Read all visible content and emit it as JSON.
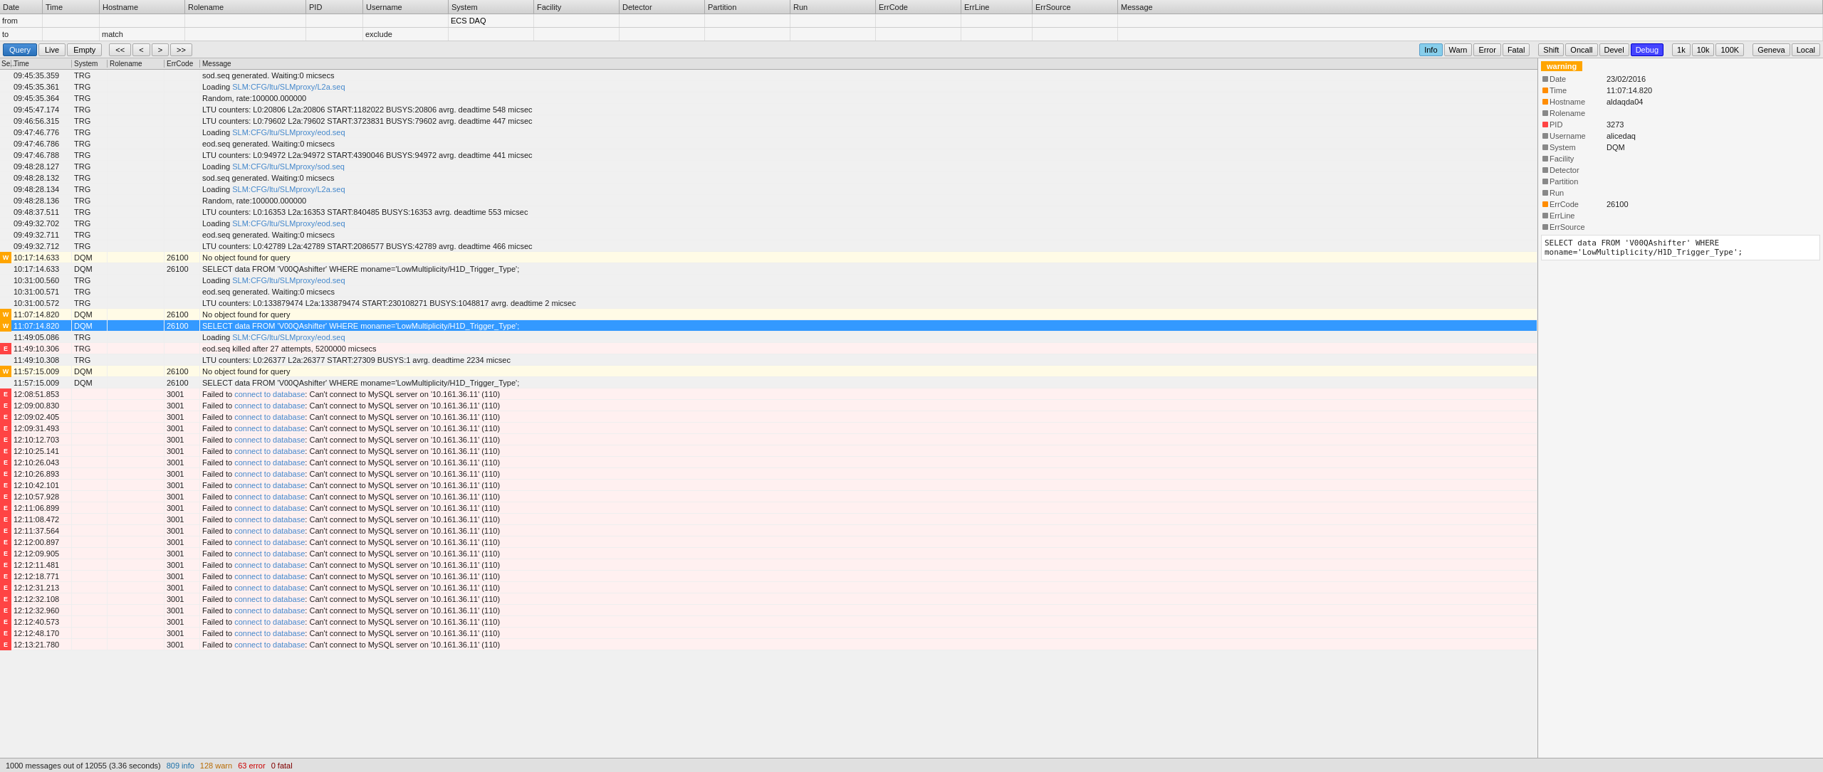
{
  "columns": {
    "headers": [
      {
        "label": "Date",
        "class": "hcol-date"
      },
      {
        "label": "Time",
        "class": "hcol-time"
      },
      {
        "label": "Hostname",
        "class": "hcol-hostname"
      },
      {
        "label": "Rolename",
        "class": "hcol-rolename"
      },
      {
        "label": "PID",
        "class": "hcol-pid"
      },
      {
        "label": "Username",
        "class": "hcol-username"
      },
      {
        "label": "System",
        "class": "hcol-system"
      },
      {
        "label": "Facility",
        "class": "hcol-facility"
      },
      {
        "label": "Detector",
        "class": "hcol-detector"
      },
      {
        "label": "Partition",
        "class": "hcol-partition"
      },
      {
        "label": "Run",
        "class": "hcol-run"
      },
      {
        "label": "ErrCode",
        "class": "hcol-errcode"
      },
      {
        "label": "ErrLine",
        "class": "hcol-errline"
      },
      {
        "label": "ErrSource",
        "class": "hcol-errsource"
      },
      {
        "label": "Message",
        "class": "hcol-message"
      }
    ]
  },
  "filters": {
    "from_label": "from",
    "to_label": "to",
    "match_label": "match",
    "exclude_label": "exclude",
    "system_value": "ECS DAQ",
    "from_value": "",
    "to_value": "",
    "match_value": "",
    "exclude_value": ""
  },
  "toolbar": {
    "query": "Query",
    "live": "Live",
    "empty": "Empty",
    "nav_first": "<<",
    "nav_prev": "<",
    "nav_next": ">",
    "nav_last": ">>",
    "info": "Info",
    "warn": "Warn",
    "error": "Error",
    "fatal": "Fatal",
    "shift": "Shift",
    "oncall": "Oncall",
    "devel": "Devel",
    "debug": "Debug",
    "1k": "1k",
    "10k": "10k",
    "100k": "100K",
    "geneva": "Geneva",
    "local": "Local"
  },
  "log_columns": {
    "seq": "Se...",
    "time": "Time",
    "system": "System",
    "rolename": "Rolename",
    "errcode": "ErrCode",
    "message": "Message"
  },
  "log_rows": [
    {
      "seq": "",
      "sev": "i",
      "time": "09:45:35.359",
      "system": "TRG",
      "rolename": "",
      "errcode": "",
      "message": "sod.seq generated. Waiting:0 micsecs"
    },
    {
      "seq": "",
      "sev": "i",
      "time": "09:45:35.361",
      "system": "TRG",
      "rolename": "",
      "errcode": "",
      "message": "Loading SLM:CFG/ltu/SLMproxy/L2a.seq"
    },
    {
      "seq": "",
      "sev": "i",
      "time": "09:45:35.364",
      "system": "TRG",
      "rolename": "",
      "errcode": "",
      "message": "Random, rate:100000.000000"
    },
    {
      "seq": "",
      "sev": "i",
      "time": "09:45:47.174",
      "system": "TRG",
      "rolename": "",
      "errcode": "",
      "message": "LTU counters: L0:20806 L2a:20806 START:1182022 BUSYS:20806 avrg. deadtime 548 micsec"
    },
    {
      "seq": "",
      "sev": "i",
      "time": "09:46:56.315",
      "system": "TRG",
      "rolename": "",
      "errcode": "",
      "message": "LTU counters: L0:79602 L2a:79602 START:3723831 BUSYS:79602 avrg. deadtime 447 micsec"
    },
    {
      "seq": "",
      "sev": "i",
      "time": "09:47:46.776",
      "system": "TRG",
      "rolename": "",
      "errcode": "",
      "message": "Loading SLM:CFG/ltu/SLMproxy/eod.seq"
    },
    {
      "seq": "",
      "sev": "i",
      "time": "09:47:46.786",
      "system": "TRG",
      "rolename": "",
      "errcode": "",
      "message": "eod.seq generated. Waiting:0 micsecs"
    },
    {
      "seq": "",
      "sev": "i",
      "time": "09:47:46.788",
      "system": "TRG",
      "rolename": "",
      "errcode": "",
      "message": "LTU counters: L0:94972 L2a:94972 START:4390046 BUSYS:94972 avrg. deadtime 441 micsec"
    },
    {
      "seq": "",
      "sev": "i",
      "time": "09:48:28.127",
      "system": "TRG",
      "rolename": "",
      "errcode": "",
      "message": "Loading SLM:CFG/ltu/SLMproxy/sod.seq"
    },
    {
      "seq": "",
      "sev": "i",
      "time": "09:48:28.132",
      "system": "TRG",
      "rolename": "",
      "errcode": "",
      "message": "sod.seq generated. Waiting:0 micsecs"
    },
    {
      "seq": "",
      "sev": "i",
      "time": "09:48:28.134",
      "system": "TRG",
      "rolename": "",
      "errcode": "",
      "message": "Loading SLM:CFG/ltu/SLMproxy/L2a.seq"
    },
    {
      "seq": "",
      "sev": "i",
      "time": "09:48:28.136",
      "system": "TRG",
      "rolename": "",
      "errcode": "",
      "message": "Random, rate:100000.000000"
    },
    {
      "seq": "",
      "sev": "i",
      "time": "09:48:37.511",
      "system": "TRG",
      "rolename": "",
      "errcode": "",
      "message": "LTU counters: L0:16353 L2a:16353 START:840485 BUSYS:16353 avrg. deadtime 553 micsec"
    },
    {
      "seq": "",
      "sev": "i",
      "time": "09:49:32.702",
      "system": "TRG",
      "rolename": "",
      "errcode": "",
      "message": "Loading SLM:CFG/ltu/SLMproxy/eod.seq"
    },
    {
      "seq": "",
      "sev": "i",
      "time": "09:49:32.711",
      "system": "TRG",
      "rolename": "",
      "errcode": "",
      "message": "eod.seq generated. Waiting:0 micsecs"
    },
    {
      "seq": "",
      "sev": "i",
      "time": "09:49:32.712",
      "system": "TRG",
      "rolename": "",
      "errcode": "",
      "message": "LTU counters: L0:42789 L2a:42789 START:2086577 BUSYS:42789 avrg. deadtime 466 micsec"
    },
    {
      "seq": "W",
      "sev": "w",
      "time": "10:17:14.633",
      "system": "DQM",
      "rolename": "",
      "errcode": "26100",
      "message": "No object found for query"
    },
    {
      "seq": "",
      "sev": "i",
      "time": "10:17:14.633",
      "system": "DQM",
      "rolename": "",
      "errcode": "26100",
      "message": "SELECT data FROM 'V00QAshifter' WHERE moname='LowMultiplicity/H1D_Trigger_Type';"
    },
    {
      "seq": "",
      "sev": "i",
      "time": "10:31:00.560",
      "system": "TRG",
      "rolename": "",
      "errcode": "",
      "message": "Loading SLM:CFG/ltu/SLMproxy/eod.seq"
    },
    {
      "seq": "",
      "sev": "i",
      "time": "10:31:00.571",
      "system": "TRG",
      "rolename": "",
      "errcode": "",
      "message": "eod.seq generated. Waiting:0 micsecs"
    },
    {
      "seq": "",
      "sev": "i",
      "time": "10:31:00.572",
      "system": "TRG",
      "rolename": "",
      "errcode": "",
      "message": "LTU counters: L0:133879474 L2a:133879474 START:230108271 BUSYS:1048817 avrg. deadtime 2 micsec"
    },
    {
      "seq": "W",
      "sev": "w",
      "time": "11:07:14.820",
      "system": "DQM",
      "rolename": "",
      "errcode": "26100",
      "message": "No object found for query"
    },
    {
      "seq": "W",
      "sev": "w",
      "time": "11:07:14.820",
      "system": "DQM",
      "rolename": "",
      "errcode": "26100",
      "message": "SELECT data FROM 'V00QAshifter' WHERE moname='LowMultiplicity/H1D_Trigger_Type';",
      "selected": true
    },
    {
      "seq": "",
      "sev": "i",
      "time": "11:49:05.086",
      "system": "TRG",
      "rolename": "",
      "errcode": "",
      "message": "Loading SLM:CFG/ltu/SLMproxy/eod.seq"
    },
    {
      "seq": "E",
      "sev": "e",
      "time": "11:49:10.306",
      "system": "TRG",
      "rolename": "",
      "errcode": "",
      "message": "eod.seq killed after 27 attempts, 5200000 micsecs"
    },
    {
      "seq": "",
      "sev": "i",
      "time": "11:49:10.308",
      "system": "TRG",
      "rolename": "",
      "errcode": "",
      "message": "LTU counters: L0:26377 L2a:26377 START:27309 BUSYS:1 avrg. deadtime 2234 micsec"
    },
    {
      "seq": "W",
      "sev": "w",
      "time": "11:57:15.009",
      "system": "DQM",
      "rolename": "",
      "errcode": "26100",
      "message": "No object found for query"
    },
    {
      "seq": "",
      "sev": "i",
      "time": "11:57:15.009",
      "system": "DQM",
      "rolename": "",
      "errcode": "26100",
      "message": "SELECT data FROM 'V00QAshifter' WHERE moname='LowMultiplicity/H1D_Trigger_Type';"
    },
    {
      "seq": "E",
      "sev": "e",
      "time": "12:08:51.853",
      "system": "",
      "rolename": "",
      "errcode": "3001",
      "message": "Failed to connect to database: Can't connect to MySQL server on '10.161.36.11' (110)"
    },
    {
      "seq": "E",
      "sev": "e",
      "time": "12:09:00.830",
      "system": "",
      "rolename": "",
      "errcode": "3001",
      "message": "Failed to connect to database: Can't connect to MySQL server on '10.161.36.11' (110)"
    },
    {
      "seq": "E",
      "sev": "e",
      "time": "12:09:02.405",
      "system": "",
      "rolename": "",
      "errcode": "3001",
      "message": "Failed to connect to database: Can't connect to MySQL server on '10.161.36.11' (110)"
    },
    {
      "seq": "E",
      "sev": "e",
      "time": "12:09:31.493",
      "system": "",
      "rolename": "",
      "errcode": "3001",
      "message": "Failed to connect to database: Can't connect to MySQL server on '10.161.36.11' (110)"
    },
    {
      "seq": "E",
      "sev": "e",
      "time": "12:10:12.703",
      "system": "",
      "rolename": "",
      "errcode": "3001",
      "message": "Failed to connect to database: Can't connect to MySQL server on '10.161.36.11' (110)"
    },
    {
      "seq": "E",
      "sev": "e",
      "time": "12:10:25.141",
      "system": "",
      "rolename": "",
      "errcode": "3001",
      "message": "Failed to connect to database: Can't connect to MySQL server on '10.161.36.11' (110)"
    },
    {
      "seq": "E",
      "sev": "e",
      "time": "12:10:26.043",
      "system": "",
      "rolename": "",
      "errcode": "3001",
      "message": "Failed to connect to database: Can't connect to MySQL server on '10.161.36.11' (110)"
    },
    {
      "seq": "E",
      "sev": "e",
      "time": "12:10:26.893",
      "system": "",
      "rolename": "",
      "errcode": "3001",
      "message": "Failed to connect to database: Can't connect to MySQL server on '10.161.36.11' (110)"
    },
    {
      "seq": "E",
      "sev": "e",
      "time": "12:10:42.101",
      "system": "",
      "rolename": "",
      "errcode": "3001",
      "message": "Failed to connect to database: Can't connect to MySQL server on '10.161.36.11' (110)"
    },
    {
      "seq": "E",
      "sev": "e",
      "time": "12:10:57.928",
      "system": "",
      "rolename": "",
      "errcode": "3001",
      "message": "Failed to connect to database: Can't connect to MySQL server on '10.161.36.11' (110)"
    },
    {
      "seq": "E",
      "sev": "e",
      "time": "12:11:06.899",
      "system": "",
      "rolename": "",
      "errcode": "3001",
      "message": "Failed to connect to database: Can't connect to MySQL server on '10.161.36.11' (110)"
    },
    {
      "seq": "E",
      "sev": "e",
      "time": "12:11:08.472",
      "system": "",
      "rolename": "",
      "errcode": "3001",
      "message": "Failed to connect to database: Can't connect to MySQL server on '10.161.36.11' (110)"
    },
    {
      "seq": "E",
      "sev": "e",
      "time": "12:11:37.564",
      "system": "",
      "rolename": "",
      "errcode": "3001",
      "message": "Failed to connect to database: Can't connect to MySQL server on '10.161.36.11' (110)"
    },
    {
      "seq": "E",
      "sev": "e",
      "time": "12:12:00.897",
      "system": "",
      "rolename": "",
      "errcode": "3001",
      "message": "Failed to connect to database: Can't connect to MySQL server on '10.161.36.11' (110)"
    },
    {
      "seq": "E",
      "sev": "e",
      "time": "12:12:09.905",
      "system": "",
      "rolename": "",
      "errcode": "3001",
      "message": "Failed to connect to database: Can't connect to MySQL server on '10.161.36.11' (110)"
    },
    {
      "seq": "E",
      "sev": "e",
      "time": "12:12:11.481",
      "system": "",
      "rolename": "",
      "errcode": "3001",
      "message": "Failed to connect to database: Can't connect to MySQL server on '10.161.36.11' (110)"
    },
    {
      "seq": "E",
      "sev": "e",
      "time": "12:12:18.771",
      "system": "",
      "rolename": "",
      "errcode": "3001",
      "message": "Failed to connect to database: Can't connect to MySQL server on '10.161.36.11' (110)"
    },
    {
      "seq": "E",
      "sev": "e",
      "time": "12:12:31.213",
      "system": "",
      "rolename": "",
      "errcode": "3001",
      "message": "Failed to connect to database: Can't connect to MySQL server on '10.161.36.11' (110)"
    },
    {
      "seq": "E",
      "sev": "e",
      "time": "12:12:32.108",
      "system": "",
      "rolename": "",
      "errcode": "3001",
      "message": "Failed to connect to database: Can't connect to MySQL server on '10.161.36.11' (110)"
    },
    {
      "seq": "E",
      "sev": "e",
      "time": "12:12:32.960",
      "system": "",
      "rolename": "",
      "errcode": "3001",
      "message": "Failed to connect to database: Can't connect to MySQL server on '10.161.36.11' (110)"
    },
    {
      "seq": "E",
      "sev": "e",
      "time": "12:12:40.573",
      "system": "",
      "rolename": "",
      "errcode": "3001",
      "message": "Failed to connect to database: Can't connect to MySQL server on '10.161.36.11' (110)"
    },
    {
      "seq": "E",
      "sev": "e",
      "time": "12:12:48.170",
      "system": "",
      "rolename": "",
      "errcode": "3001",
      "message": "Failed to connect to database: Can't connect to MySQL server on '10.161.36.11' (110)"
    },
    {
      "seq": "E",
      "sev": "e",
      "time": "12:13:21.780",
      "system": "",
      "rolename": "",
      "errcode": "3001",
      "message": "Failed to connect to database: Can't connect to MySQL server on '10.161.36.11' (110)"
    }
  ],
  "detail": {
    "severity_label": "warning",
    "date": "23/02/2016",
    "time": "11:07:14.820",
    "hostname": "aldaqda04",
    "rolename": "",
    "pid": "3273",
    "username": "alicedaq",
    "system": "DQM",
    "facility": "",
    "detector": "",
    "partition": "",
    "run": "",
    "errcode": "26100",
    "errline": "",
    "errsource": "",
    "sql": "SELECT data FROM 'V00QAshifter' WHERE moname='LowMultiplicity/H1D_Trigger_Type';"
  },
  "status": {
    "total": "1000 messages out of 12055 (3.36 seconds)",
    "info_count": "809 info",
    "warn_count": "128 warn",
    "error_count": "63 error",
    "fatal_count": "0 fatal"
  }
}
